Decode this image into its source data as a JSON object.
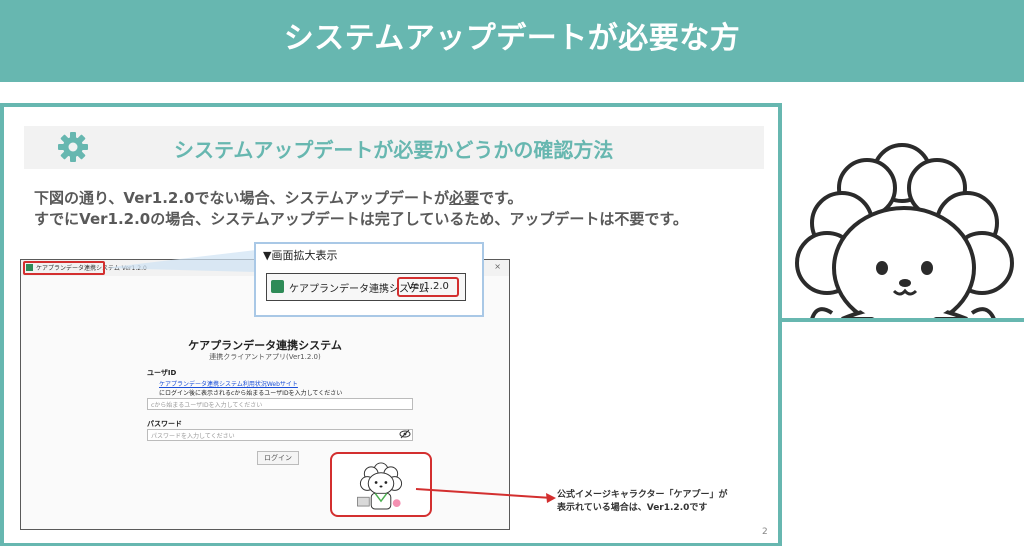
{
  "header": {
    "title": "システムアップデートが必要な方"
  },
  "section": {
    "icon": "gear-icon",
    "title": "システムアップデートが必要かどうかの確認方法"
  },
  "description": {
    "line1_pre": "下図の通り、Ver1.2.0でない場合、システムアップデートが",
    "line1_emph": "必要",
    "line1_post": "です。",
    "line2": "すでにVer1.2.0の場合、システムアップデートは完了しているため、アップデートは不要です。"
  },
  "window": {
    "title": "ケアプランデータ連携システム Ver1.2.0",
    "close": "×",
    "app_title": "ケアプランデータ連携システム",
    "app_subtitle": "連携クライアントアプリ(Ver1.2.0)",
    "userid_label": "ユーザID",
    "userid_link": "ケアプランデータ連携システム利用状況Webサイト",
    "userid_help": "にログイン後に表示されるcから始まるユーザIDを入力してください",
    "userid_placeholder": "cから始まるユーザIDを入力してください",
    "password_label": "パスワード",
    "password_placeholder": "パスワードを入力してください",
    "login_button": "ログイン"
  },
  "zoom": {
    "title": "▼画面拡大表示",
    "app_name": "ケアプランデータ連携システム",
    "version": "Ver1.2.0"
  },
  "note": {
    "line1": "公式イメージキャラクター「ケアプー」が",
    "line2": "表示れている場合は、Ver1.2.0です"
  },
  "page_number": "2",
  "colors": {
    "accent": "#67b7b0",
    "highlight": "#d32f2f",
    "text": "#595959"
  }
}
